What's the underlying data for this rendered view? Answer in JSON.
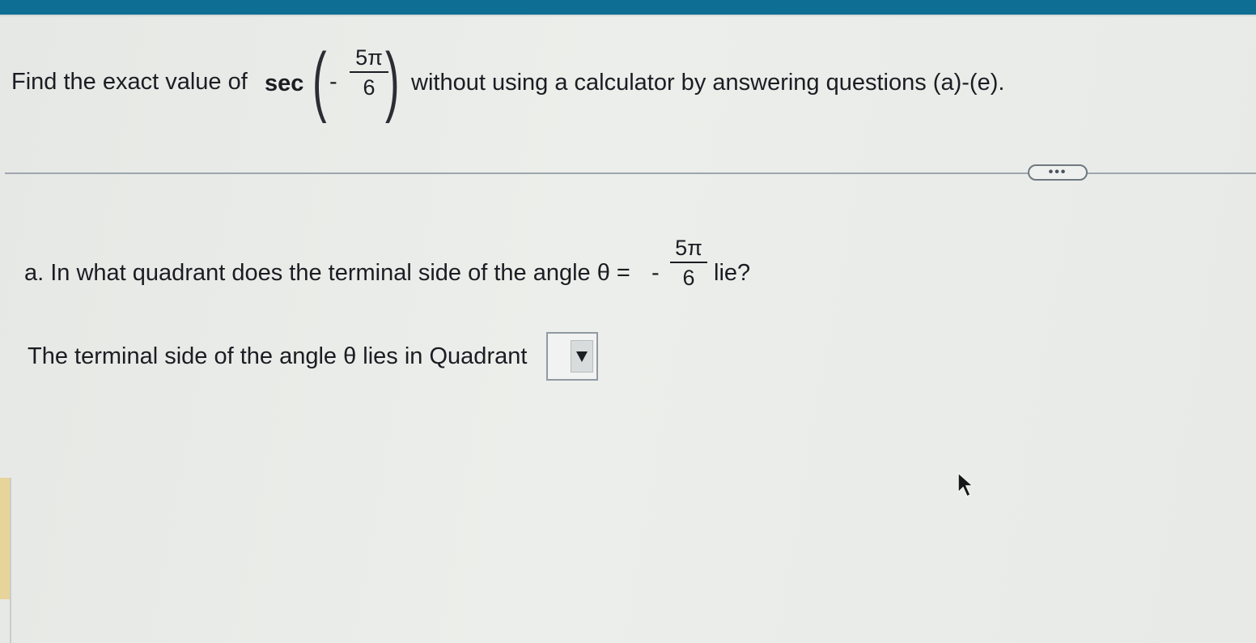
{
  "question": {
    "prefix": "Find the exact value of",
    "func": "sec",
    "minus": "-",
    "numerator": "5π",
    "denominator": "6",
    "suffix": "without using a calculator by answering questions (a)-(e)."
  },
  "more_button": {
    "label": "•••"
  },
  "part_a": {
    "prompt_before": "a. In what quadrant does the terminal side of the angle θ =",
    "minus": "-",
    "numerator": "5π",
    "denominator": "6",
    "prompt_after": "lie?"
  },
  "answer": {
    "label": "The terminal side of the angle θ lies in Quadrant",
    "selected_value": ""
  },
  "colors": {
    "top_bar": "#0f6e93",
    "background": "#e9ebe8",
    "text": "#1a1d22"
  },
  "icons": {
    "dropdown": "triangle-down-icon",
    "cursor": "mouse-pointer-icon"
  }
}
